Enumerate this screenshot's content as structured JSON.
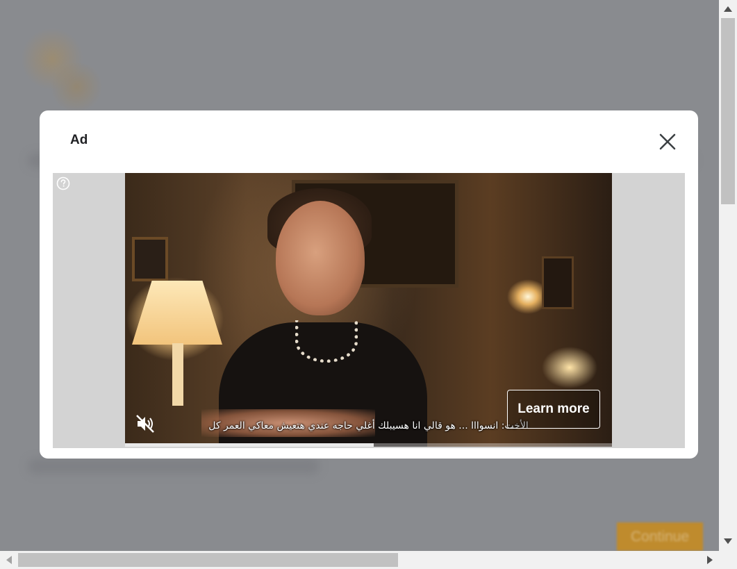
{
  "modal": {
    "title": "Ad",
    "close_icon": "close-icon"
  },
  "ad": {
    "help_icon": "help-circle-icon",
    "subtitle": "الأخت: انسوااا ... هو قالي انا هسيبلك أغلي حاجه عندي هتعيش معاكي العمر كل",
    "learn_more_label": "Learn more",
    "mute_icon": "volume-muted-icon",
    "progress": 0.51
  },
  "background_page": {
    "continue_label": "Continue",
    "accent_color": "#bf8b2d"
  },
  "scrollbars": {
    "vertical": {
      "up_icon": "arrow-up-icon",
      "down_icon": "arrow-down-icon"
    },
    "horizontal": {
      "left_icon": "arrow-left-icon",
      "right_icon": "arrow-right-icon"
    }
  }
}
